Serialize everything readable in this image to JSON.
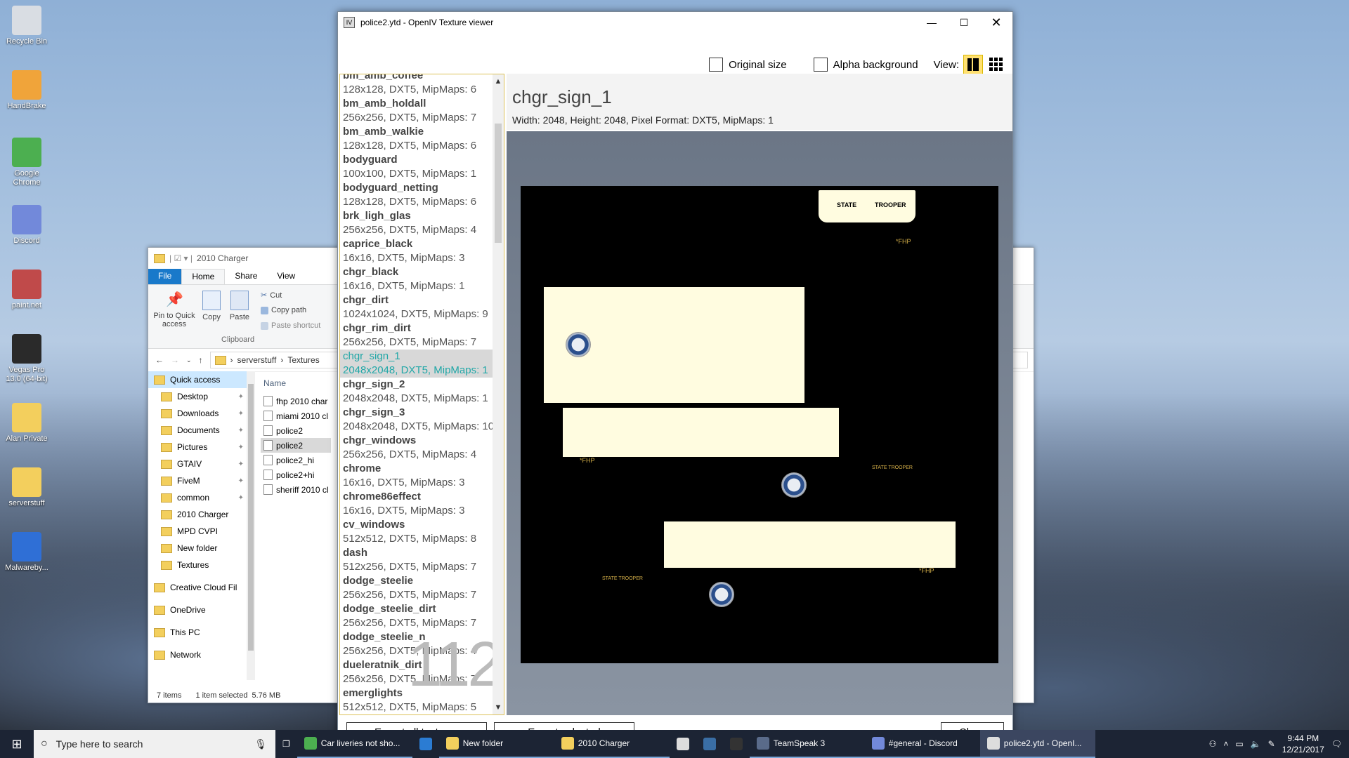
{
  "desktop": {
    "icons": [
      {
        "label": "Recycle Bin",
        "color": "#d9dde3"
      },
      {
        "label": "HandBrake",
        "color": "#f0a43a"
      },
      {
        "label": "Google Chrome",
        "color": "#4caf50"
      },
      {
        "label": "Discord",
        "color": "#7289da"
      },
      {
        "label": "paint.net",
        "color": "#c04a4a"
      },
      {
        "label": "Vegas Pro 13.0 (64-bit)",
        "color": "#2a2a2a"
      },
      {
        "label": "Alan Private",
        "color": "#f3cf5d"
      },
      {
        "label": "serverstuff",
        "color": "#f3cf5d"
      },
      {
        "label": "Malwareby...",
        "color": "#2f6fd6"
      }
    ]
  },
  "explorer": {
    "title": "2010 Charger",
    "tabs": {
      "file": "File",
      "home": "Home",
      "share": "Share",
      "view": "View"
    },
    "ribbon": {
      "pin": "Pin to Quick access",
      "copy": "Copy",
      "paste": "Paste",
      "cut": "Cut",
      "copy_path": "Copy path",
      "paste_shortcut": "Paste shortcut",
      "group": "Clipboard"
    },
    "address": {
      "seg1": "serverstuff",
      "seg2": "Textures"
    },
    "nav": [
      {
        "label": "Quick access",
        "pin": false
      },
      {
        "label": "Desktop",
        "pin": true
      },
      {
        "label": "Downloads",
        "pin": true
      },
      {
        "label": "Documents",
        "pin": true
      },
      {
        "label": "Pictures",
        "pin": true
      },
      {
        "label": "GTAIV",
        "pin": true
      },
      {
        "label": "FiveM",
        "pin": true
      },
      {
        "label": "common",
        "pin": true
      },
      {
        "label": "2010 Charger",
        "pin": false
      },
      {
        "label": "MPD CVPI",
        "pin": false
      },
      {
        "label": "New folder",
        "pin": false
      },
      {
        "label": "Textures",
        "pin": false
      },
      {
        "label": "Creative Cloud Fil",
        "pin": false
      },
      {
        "label": "OneDrive",
        "pin": false
      },
      {
        "label": "This PC",
        "pin": false
      },
      {
        "label": "Network",
        "pin": false
      }
    ],
    "files_header": "Name",
    "files": [
      "fhp 2010 char",
      "miami 2010 cl",
      "police2",
      "police2",
      "police2_hi",
      "police2+hi",
      "sheriff 2010 cl"
    ],
    "status": {
      "items": "7 items",
      "selected": "1 item selected",
      "size": "5.76 MB"
    }
  },
  "openiv": {
    "title": "police2.ytd - OpenIV Texture viewer",
    "toolbar": {
      "original_size": "Original size",
      "alpha_background": "Alpha background",
      "view": "View:"
    },
    "textures": [
      {
        "name": "bm_amb_coffee",
        "desc": "128x128, DXT5, MipMaps: 6"
      },
      {
        "name": "bm_amb_holdall",
        "desc": "256x256, DXT5, MipMaps: 7"
      },
      {
        "name": "bm_amb_walkie",
        "desc": "128x128, DXT5, MipMaps: 6"
      },
      {
        "name": "bodyguard",
        "desc": "100x100, DXT5, MipMaps: 1"
      },
      {
        "name": "bodyguard_netting",
        "desc": "128x128, DXT5, MipMaps: 6"
      },
      {
        "name": "brk_ligh_glas",
        "desc": "256x256, DXT5, MipMaps: 4"
      },
      {
        "name": "caprice_black",
        "desc": "16x16, DXT5, MipMaps: 3"
      },
      {
        "name": "chgr_black",
        "desc": "16x16, DXT5, MipMaps: 1"
      },
      {
        "name": "chgr_dirt",
        "desc": "1024x1024, DXT5, MipMaps: 9"
      },
      {
        "name": "chgr_rim_dirt",
        "desc": "256x256, DXT5, MipMaps: 7"
      },
      {
        "name": "chgr_sign_1",
        "desc": "2048x2048, DXT5, MipMaps: 1",
        "selected": true
      },
      {
        "name": "chgr_sign_2",
        "desc": "2048x2048, DXT5, MipMaps: 1"
      },
      {
        "name": "chgr_sign_3",
        "desc": "2048x2048, DXT5, MipMaps: 10"
      },
      {
        "name": "chgr_windows",
        "desc": "256x256, DXT5, MipMaps: 4"
      },
      {
        "name": "chrome",
        "desc": "16x16, DXT5, MipMaps: 3"
      },
      {
        "name": "chrome86effect",
        "desc": "16x16, DXT5, MipMaps: 3"
      },
      {
        "name": "cv_windows",
        "desc": "512x512, DXT5, MipMaps: 8"
      },
      {
        "name": "dash",
        "desc": "512x256, DXT5, MipMaps: 7"
      },
      {
        "name": "dodge_steelie",
        "desc": "256x256, DXT5, MipMaps: 7"
      },
      {
        "name": "dodge_steelie_dirt",
        "desc": "256x256, DXT5, MipMaps: 7"
      },
      {
        "name": "dodge_steelie_n",
        "desc": "256x256, DXT5, MipMaps: 4"
      },
      {
        "name": "dueleratnik_dirt",
        "desc": "256x256, DXT5, MipMaps: 7"
      },
      {
        "name": "emerglights",
        "desc": "512x512, DXT5, MipMaps: 5"
      }
    ],
    "count": "112",
    "selected": {
      "name": "chgr_sign_1",
      "meta": "Width: 2048, Height: 2048, Pixel Format: DXT5, MipMaps: 1"
    },
    "texture_labels": {
      "state": "STATE",
      "trooper": "TROOPER",
      "fhp": "*FHP",
      "state_trooper": "STATE TROOPER"
    },
    "buttons": {
      "export_all": "Export all textures",
      "export_selected": "Export selected",
      "close": "Close"
    }
  },
  "taskbar": {
    "search_placeholder": "Type here to search",
    "items": [
      {
        "label": "Car liveries not sho...",
        "color": "#4caf50"
      },
      {
        "label": "",
        "color": "#2b7cd3"
      },
      {
        "label": "New folder",
        "color": "#f3cf5d"
      },
      {
        "label": "2010 Charger",
        "color": "#f3cf5d"
      },
      {
        "label": "",
        "color": "#dddddd"
      },
      {
        "label": "",
        "color": "#3a6ea5"
      },
      {
        "label": "",
        "color": "#333333"
      },
      {
        "label": "TeamSpeak 3",
        "color": "#5a6b8a"
      },
      {
        "label": "#general - Discord",
        "color": "#7289da"
      },
      {
        "label": "police2.ytd - OpenI...",
        "color": "#dddddd"
      }
    ],
    "time": "9:44 PM",
    "date": "12/21/2017"
  }
}
